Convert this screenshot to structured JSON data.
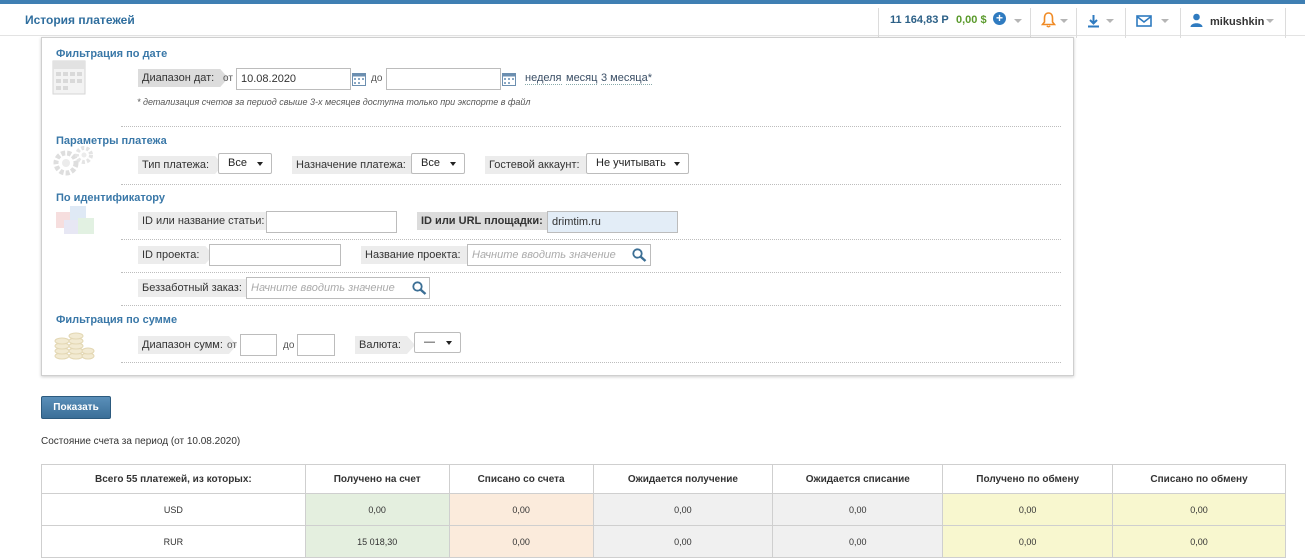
{
  "header": {
    "title": "История платежей",
    "balance_rub": "11 164,83 Р",
    "balance_usd": "0,00 $",
    "username": "mikushkin"
  },
  "icons": {
    "plus": "plus-circle-icon",
    "bell": "bell-icon",
    "download": "download-icon",
    "mail": "envelope-icon",
    "user": "user-icon",
    "calendar": "calendar-icon",
    "search": "magnifier-icon"
  },
  "colors": {
    "accent": "#3f7fb3",
    "section_title": "#3a78a8",
    "bell": "#f08a24",
    "usd": "#5a9a2b"
  },
  "date_filter": {
    "title": "Фильтрация по дате",
    "range_label": "Диапазон дат:",
    "from_label": "от",
    "from_value": "10.08.2020",
    "to_label": "до",
    "to_value": "",
    "link_week": "неделя",
    "link_month": "месяц",
    "link_3months": "3 месяца*",
    "note": "* детализация счетов за период свыше 3-х месяцев доступна только при экспорте в файл"
  },
  "payment_params": {
    "title": "Параметры платежа",
    "type_label": "Тип платежа:",
    "type_value": "Все",
    "purpose_label": "Назначение платежа:",
    "purpose_value": "Все",
    "guest_label": "Гостевой аккаунт:",
    "guest_value": "Не учитывать"
  },
  "identifier": {
    "title": "По идентификатору",
    "article_label": "ID или название статьи:",
    "article_value": "",
    "site_label": "ID или URL площадки:",
    "site_value": "drimtim.ru",
    "project_id_label": "ID проекта:",
    "project_id_value": "",
    "project_name_label": "Название проекта:",
    "project_name_placeholder": "Начните вводить значение",
    "order_label": "Беззаботный заказ:",
    "order_placeholder": "Начните вводить значение"
  },
  "sum_filter": {
    "title": "Фильтрация по сумме",
    "range_label": "Диапазон сумм:",
    "from_label": "от",
    "to_label": "до",
    "currency_label": "Валюта:",
    "currency_value": "—"
  },
  "actions": {
    "show_button": "Показать"
  },
  "state_text": "Состояние счета за период (от 10.08.2020)",
  "summary_table": {
    "headers": [
      "Всего 55 платежей, из которых:",
      "Получено на счет",
      "Списано со счета",
      "Ожидается получение",
      "Ожидается списание",
      "Получено по обмену",
      "Списано по обмену"
    ],
    "rows": [
      [
        "USD",
        "0,00",
        "0,00",
        "0,00",
        "0,00",
        "0,00",
        "0,00"
      ],
      [
        "RUR",
        "15 018,30",
        "0,00",
        "0,00",
        "0,00",
        "0,00",
        "0,00"
      ]
    ]
  }
}
